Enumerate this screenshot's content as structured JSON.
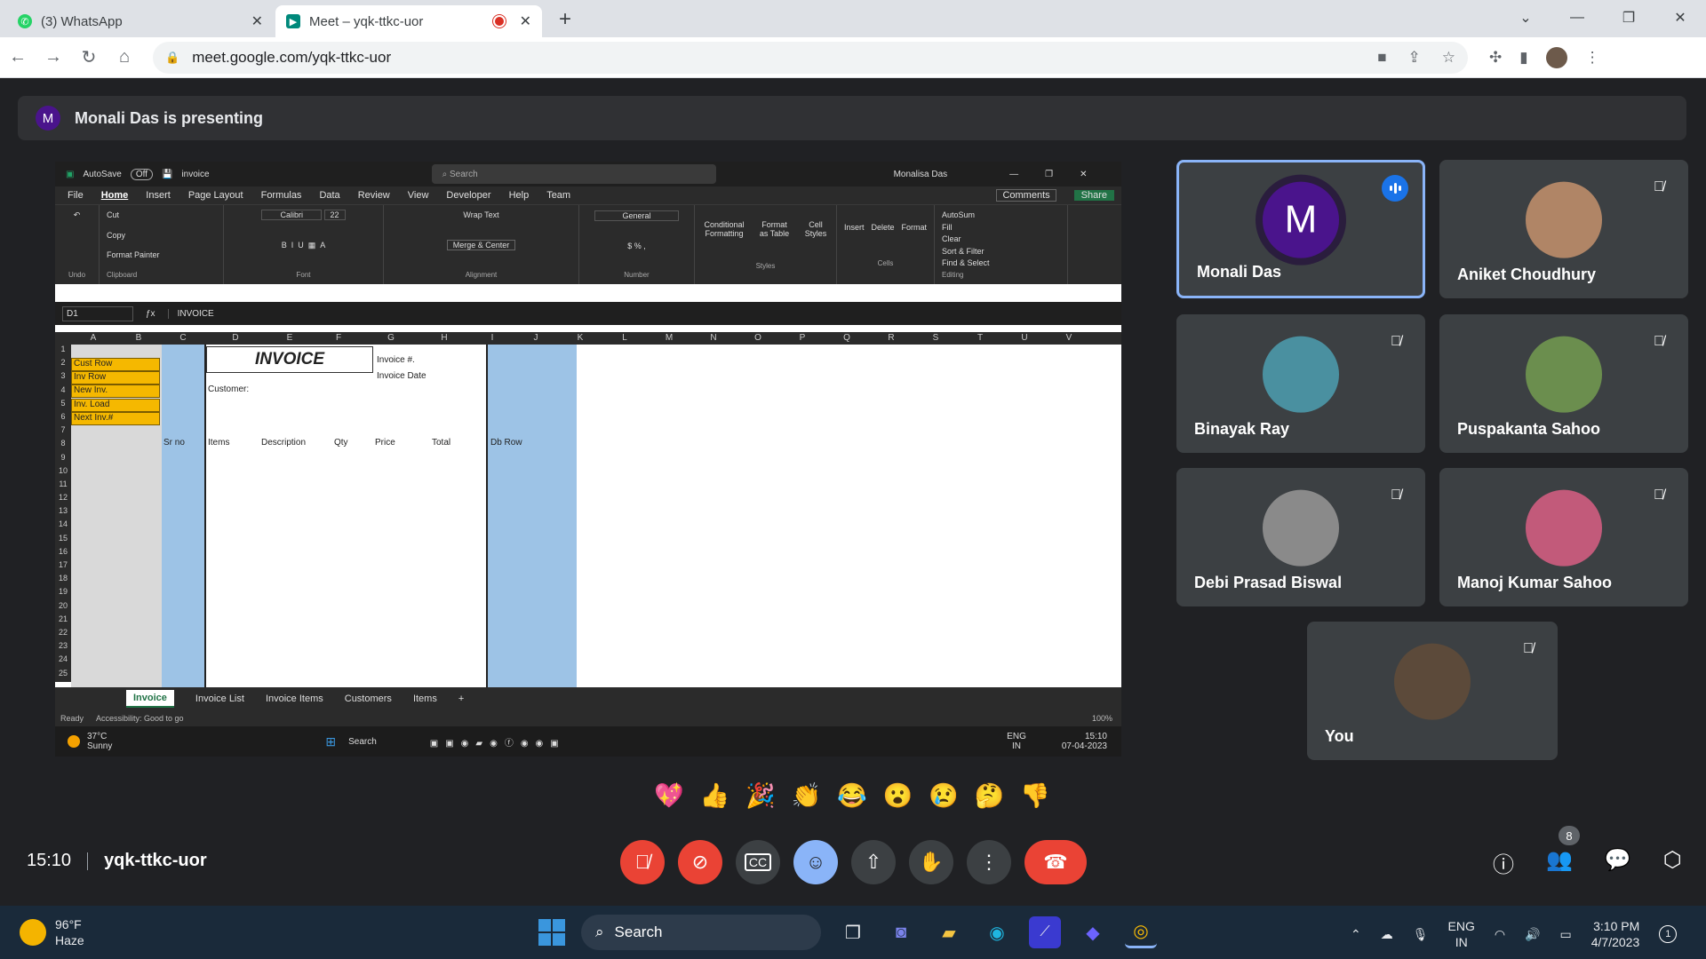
{
  "browser": {
    "tabs": [
      {
        "label": "(3) WhatsApp",
        "active": false
      },
      {
        "label": "Meet – yqk-ttkc-uor",
        "active": true
      }
    ],
    "url": "meet.google.com/yqk-ttkc-uor"
  },
  "meet": {
    "presenter_initial": "M",
    "presenting_text": "Monali Das is presenting",
    "meeting_time": "15:10",
    "meeting_code": "yqk-ttkc-uor",
    "participants_count": "8",
    "reactions": [
      "💖",
      "👍",
      "🎉",
      "👏",
      "😂",
      "😮",
      "😢",
      "🤔",
      "👎"
    ],
    "participants": [
      {
        "name": "Monali Das",
        "initial": "M",
        "speaking": true
      },
      {
        "name": "Aniket Choudhury",
        "muted": true
      },
      {
        "name": "Binayak Ray",
        "muted": true
      },
      {
        "name": "Puspakanta Sahoo",
        "muted": true
      },
      {
        "name": "Debi Prasad Biswal",
        "muted": true
      },
      {
        "name": "Manoj Kumar Sahoo",
        "muted": true
      },
      {
        "name": "You",
        "muted": true
      }
    ]
  },
  "excel": {
    "autosave": "AutoSave",
    "autosave_state": "Off",
    "filename": "invoice",
    "search_placeholder": "Search",
    "user": "Monalisa Das",
    "comments": "Comments",
    "share": "Share",
    "menu": [
      "File",
      "Home",
      "Insert",
      "Page Layout",
      "Formulas",
      "Data",
      "Review",
      "View",
      "Developer",
      "Help",
      "Team"
    ],
    "ribbon": {
      "undo": "Undo",
      "clipboard": "Clipboard",
      "cut": "Cut",
      "copy": "Copy",
      "format_painter": "Format Painter",
      "font_name": "Calibri",
      "font_size": "22",
      "font_group": "Font",
      "wrap_text": "Wrap Text",
      "merge_center": "Merge & Center",
      "alignment_group": "Alignment",
      "number_format": "General",
      "number_group": "Number",
      "conditional": "Conditional Formatting",
      "format_table": "Format as Table",
      "cell_styles": "Cell Styles",
      "styles_group": "Styles",
      "insert": "Insert",
      "delete": "Delete",
      "format": "Format",
      "cells_group": "Cells",
      "autosum": "AutoSum",
      "fill": "Fill",
      "clear": "Clear",
      "sort_filter": "Sort & Filter",
      "find_select": "Find & Select",
      "editing_group": "Editing"
    },
    "name_box": "D1",
    "formula": "INVOICE",
    "columns": [
      "A",
      "B",
      "C",
      "D",
      "E",
      "F",
      "G",
      "H",
      "I",
      "J",
      "K",
      "L",
      "M",
      "N",
      "O",
      "P",
      "Q",
      "R",
      "S",
      "T",
      "U",
      "V"
    ],
    "rows": [
      "1",
      "2",
      "3",
      "4",
      "5",
      "6",
      "7",
      "8",
      "9",
      "10",
      "11",
      "12",
      "13",
      "14",
      "15",
      "16",
      "17",
      "18",
      "19",
      "20",
      "21",
      "22",
      "23",
      "24",
      "25"
    ],
    "labels_b": [
      "Cust Row",
      "Inv Row",
      "New Inv.",
      "Inv. Load",
      "Next Inv.#"
    ],
    "invoice_title": "INVOICE",
    "invoice_no": "Invoice #.",
    "invoice_date": "Invoice Date",
    "customer": "Customer:",
    "header_row": [
      "Sr no",
      "Items",
      "Description",
      "Qty",
      "Price",
      "Total",
      "Db Row"
    ],
    "sheet_tabs": [
      "Invoice",
      "Invoice List",
      "Invoice Items",
      "Customers",
      "Items"
    ],
    "status_ready": "Ready",
    "accessibility": "Accessibility: Good to go",
    "zoom": "100%"
  },
  "inner_taskbar": {
    "temp": "37°C",
    "cond": "Sunny",
    "search": "Search",
    "lang1": "ENG",
    "lang2": "IN",
    "time": "15:10",
    "date": "07-04-2023"
  },
  "taskbar": {
    "temp": "96°F",
    "cond": "Haze",
    "search": "Search",
    "lang1": "ENG",
    "lang2": "IN",
    "time": "3:10 PM",
    "date": "4/7/2023",
    "notif": "1"
  },
  "colors": {
    "meet_bg": "#202124",
    "tile": "#3c4043",
    "red": "#ea4335",
    "blue": "#8ab4f8",
    "excel_green": "#217346"
  }
}
